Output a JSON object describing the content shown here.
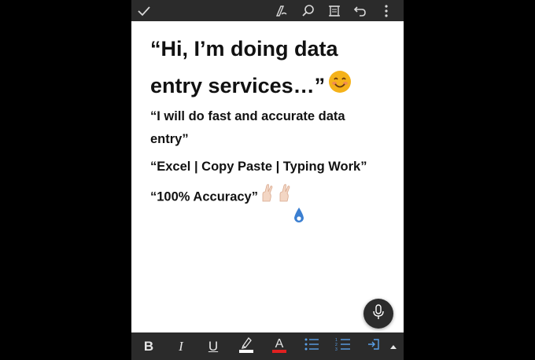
{
  "topbar": {
    "icons": [
      "checkmark-icon",
      "pen-icon",
      "search-icon",
      "fit-page-icon",
      "undo-icon",
      "more-icon"
    ]
  },
  "document": {
    "heading": "“Hi, I’m doing data entry services…”",
    "line1": "“I will do fast and accurate data entry”",
    "line2": "“Excel | Copy Paste | Typing Work”",
    "line3": "“100% Accuracy”"
  },
  "format_toolbar": {
    "bold": "B",
    "italic": "I",
    "underline": "U",
    "font_color": "A",
    "highlight_color": "#ffffff",
    "font_color_swatch": "#e02020"
  },
  "colors": {
    "bar_background": "#2b2b2b",
    "page_background": "#ffffff",
    "drop_blue": "#3b7fd1",
    "emoji_yellow": "#f5b21a"
  }
}
